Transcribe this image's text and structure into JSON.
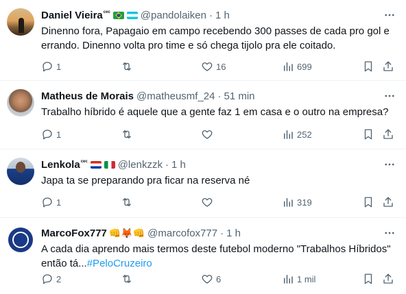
{
  "tweets": [
    {
      "name": "Daniel Vieira",
      "affil": "cec",
      "handle": "@pandolaiken",
      "time": "1 h",
      "text": "Dinenno fora, Papagaio em campo recebendo 300 passes de cada pro gol e errando. Dinenno volta pro time e só chega tijolo pra ele coitado.",
      "replies": "1",
      "retweets": "",
      "likes": "16",
      "views": "699"
    },
    {
      "name": "Matheus de Morais",
      "handle": "@matheusmf_24",
      "time": "51 min",
      "text": "Trabalho híbrido é aquele que a gente faz 1 em casa e o outro na empresa?",
      "replies": "1",
      "retweets": "",
      "likes": "",
      "views": "252"
    },
    {
      "name": "Lenkola",
      "affil": "cec",
      "handle": "@lenkzzk",
      "time": "1 h",
      "text": "Japa ta se preparando pra ficar na reserva né",
      "replies": "1",
      "retweets": "",
      "likes": "",
      "views": "319"
    },
    {
      "name": "MarcoFox777",
      "emojis": "👊🦊👊",
      "handle": "@marcofox777",
      "time": "1 h",
      "text_plain": "A cada dia aprendo mais termos deste futebol moderno \"Trabalhos Híbridos\" então tá...",
      "hashtag": "#PeloCruzeiro",
      "replies": "2",
      "retweets": "",
      "likes": "6",
      "views": "1 mil"
    }
  ],
  "separator": "·",
  "more_glyph": "···",
  "colors": {
    "text": "#0f1419",
    "muted": "#536471",
    "link": "#1d9bf0",
    "divider": "#eff3f4"
  },
  "icons": [
    "reply-icon",
    "retweet-icon",
    "like-icon",
    "views-icon",
    "bookmark-icon",
    "share-icon",
    "more-icon"
  ]
}
